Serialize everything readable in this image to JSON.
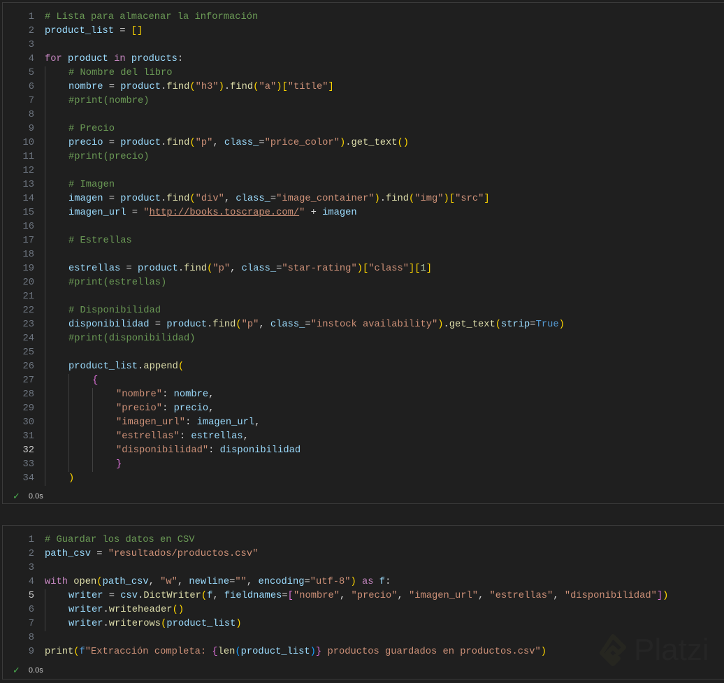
{
  "cells": [
    {
      "active_line": 32,
      "status_time": "0.0s",
      "lines": [
        [
          [
            "c",
            "# Lista para almacenar la información"
          ]
        ],
        [
          [
            "v",
            "product_list"
          ],
          [
            "p",
            " = "
          ],
          [
            "b1",
            "[]"
          ]
        ],
        [],
        [
          [
            "k",
            "for"
          ],
          [
            "p",
            " "
          ],
          [
            "v",
            "product"
          ],
          [
            "p",
            " "
          ],
          [
            "k",
            "in"
          ],
          [
            "p",
            " "
          ],
          [
            "v",
            "products"
          ],
          [
            "p",
            ":"
          ]
        ],
        [
          [
            "p",
            "    "
          ],
          [
            "c",
            "# Nombre del libro"
          ]
        ],
        [
          [
            "p",
            "    "
          ],
          [
            "v",
            "nombre"
          ],
          [
            "p",
            " = "
          ],
          [
            "v",
            "product"
          ],
          [
            "p",
            "."
          ],
          [
            "f",
            "find"
          ],
          [
            "b1",
            "("
          ],
          [
            "s",
            "\"h3\""
          ],
          [
            "b1",
            ")"
          ],
          [
            "p",
            "."
          ],
          [
            "f",
            "find"
          ],
          [
            "b1",
            "("
          ],
          [
            "s",
            "\"a\""
          ],
          [
            "b1",
            ")"
          ],
          [
            "b1",
            "["
          ],
          [
            "s",
            "\"title\""
          ],
          [
            "b1",
            "]"
          ]
        ],
        [
          [
            "p",
            "    "
          ],
          [
            "c",
            "#print(nombre)"
          ]
        ],
        [
          [
            "p",
            "    "
          ]
        ],
        [
          [
            "p",
            "    "
          ],
          [
            "c",
            "# Precio"
          ]
        ],
        [
          [
            "p",
            "    "
          ],
          [
            "v",
            "precio"
          ],
          [
            "p",
            " = "
          ],
          [
            "v",
            "product"
          ],
          [
            "p",
            "."
          ],
          [
            "f",
            "find"
          ],
          [
            "b1",
            "("
          ],
          [
            "s",
            "\"p\""
          ],
          [
            "p",
            ", "
          ],
          [
            "v",
            "class_"
          ],
          [
            "p",
            "="
          ],
          [
            "s",
            "\"price_color\""
          ],
          [
            "b1",
            ")"
          ],
          [
            "p",
            "."
          ],
          [
            "f",
            "get_text"
          ],
          [
            "b1",
            "()"
          ]
        ],
        [
          [
            "p",
            "    "
          ],
          [
            "c",
            "#print(precio)"
          ]
        ],
        [
          [
            "p",
            "    "
          ]
        ],
        [
          [
            "p",
            "    "
          ],
          [
            "c",
            "# Imagen"
          ]
        ],
        [
          [
            "p",
            "    "
          ],
          [
            "v",
            "imagen"
          ],
          [
            "p",
            " = "
          ],
          [
            "v",
            "product"
          ],
          [
            "p",
            "."
          ],
          [
            "f",
            "find"
          ],
          [
            "b1",
            "("
          ],
          [
            "s",
            "\"div\""
          ],
          [
            "p",
            ", "
          ],
          [
            "v",
            "class_"
          ],
          [
            "p",
            "="
          ],
          [
            "s",
            "\"image_container\""
          ],
          [
            "b1",
            ")"
          ],
          [
            "p",
            "."
          ],
          [
            "f",
            "find"
          ],
          [
            "b1",
            "("
          ],
          [
            "s",
            "\"img\""
          ],
          [
            "b1",
            ")"
          ],
          [
            "b1",
            "["
          ],
          [
            "s",
            "\"src\""
          ],
          [
            "b1",
            "]"
          ]
        ],
        [
          [
            "p",
            "    "
          ],
          [
            "v",
            "imagen_url"
          ],
          [
            "p",
            " = "
          ],
          [
            "s",
            "\""
          ],
          [
            "u",
            "http://books.toscrape.com/"
          ],
          [
            "s",
            "\""
          ],
          [
            "p",
            " + "
          ],
          [
            "v",
            "imagen"
          ]
        ],
        [
          [
            "p",
            "    "
          ]
        ],
        [
          [
            "p",
            "    "
          ],
          [
            "c",
            "# Estrellas"
          ]
        ],
        [
          [
            "p",
            "    "
          ]
        ],
        [
          [
            "p",
            "    "
          ],
          [
            "v",
            "estrellas"
          ],
          [
            "p",
            " = "
          ],
          [
            "v",
            "product"
          ],
          [
            "p",
            "."
          ],
          [
            "f",
            "find"
          ],
          [
            "b1",
            "("
          ],
          [
            "s",
            "\"p\""
          ],
          [
            "p",
            ", "
          ],
          [
            "v",
            "class_"
          ],
          [
            "p",
            "="
          ],
          [
            "s",
            "\"star-rating\""
          ],
          [
            "b1",
            ")"
          ],
          [
            "b1",
            "["
          ],
          [
            "s",
            "\"class\""
          ],
          [
            "b1",
            "]"
          ],
          [
            "b1",
            "["
          ],
          [
            "num",
            "1"
          ],
          [
            "b1",
            "]"
          ]
        ],
        [
          [
            "p",
            "    "
          ],
          [
            "c",
            "#print(estrellas)"
          ]
        ],
        [
          [
            "p",
            "    "
          ]
        ],
        [
          [
            "p",
            "    "
          ],
          [
            "c",
            "# Disponibilidad"
          ]
        ],
        [
          [
            "p",
            "    "
          ],
          [
            "v",
            "disponibilidad"
          ],
          [
            "p",
            " = "
          ],
          [
            "v",
            "product"
          ],
          [
            "p",
            "."
          ],
          [
            "f",
            "find"
          ],
          [
            "b1",
            "("
          ],
          [
            "s",
            "\"p\""
          ],
          [
            "p",
            ", "
          ],
          [
            "v",
            "class_"
          ],
          [
            "p",
            "="
          ],
          [
            "s",
            "\"instock availability\""
          ],
          [
            "b1",
            ")"
          ],
          [
            "p",
            "."
          ],
          [
            "f",
            "get_text"
          ],
          [
            "b1",
            "("
          ],
          [
            "v",
            "strip"
          ],
          [
            "p",
            "="
          ],
          [
            "n",
            "True"
          ],
          [
            "b1",
            ")"
          ]
        ],
        [
          [
            "p",
            "    "
          ],
          [
            "c",
            "#print(disponibilidad)"
          ]
        ],
        [
          [
            "p",
            "    "
          ]
        ],
        [
          [
            "p",
            "    "
          ],
          [
            "v",
            "product_list"
          ],
          [
            "p",
            "."
          ],
          [
            "f",
            "append"
          ],
          [
            "b1",
            "("
          ]
        ],
        [
          [
            "p",
            "        "
          ],
          [
            "b2",
            "{"
          ]
        ],
        [
          [
            "p",
            "            "
          ],
          [
            "s",
            "\"nombre\""
          ],
          [
            "p",
            ": "
          ],
          [
            "v",
            "nombre"
          ],
          [
            "p",
            ","
          ]
        ],
        [
          [
            "p",
            "            "
          ],
          [
            "s",
            "\"precio\""
          ],
          [
            "p",
            ": "
          ],
          [
            "v",
            "precio"
          ],
          [
            "p",
            ","
          ]
        ],
        [
          [
            "p",
            "            "
          ],
          [
            "s",
            "\"imagen_url\""
          ],
          [
            "p",
            ": "
          ],
          [
            "v",
            "imagen_url"
          ],
          [
            "p",
            ","
          ]
        ],
        [
          [
            "p",
            "            "
          ],
          [
            "s",
            "\"estrellas\""
          ],
          [
            "p",
            ": "
          ],
          [
            "v",
            "estrellas"
          ],
          [
            "p",
            ","
          ]
        ],
        [
          [
            "p",
            "            "
          ],
          [
            "s",
            "\"disponibilidad\""
          ],
          [
            "p",
            ": "
          ],
          [
            "v",
            "disponibilidad"
          ]
        ],
        [
          [
            "p",
            "            "
          ],
          [
            "b2",
            "}"
          ]
        ],
        [
          [
            "p",
            "    "
          ],
          [
            "b1",
            ")"
          ]
        ]
      ]
    },
    {
      "active_line": 5,
      "status_time": "0.0s",
      "lines": [
        [
          [
            "c",
            "# Guardar los datos en CSV"
          ]
        ],
        [
          [
            "v",
            "path_csv"
          ],
          [
            "p",
            " = "
          ],
          [
            "s",
            "\"resultados/productos.csv\""
          ]
        ],
        [],
        [
          [
            "k",
            "with"
          ],
          [
            "p",
            " "
          ],
          [
            "f",
            "open"
          ],
          [
            "b1",
            "("
          ],
          [
            "v",
            "path_csv"
          ],
          [
            "p",
            ", "
          ],
          [
            "s",
            "\"w\""
          ],
          [
            "p",
            ", "
          ],
          [
            "v",
            "newline"
          ],
          [
            "p",
            "="
          ],
          [
            "s",
            "\"\""
          ],
          [
            "p",
            ", "
          ],
          [
            "v",
            "encoding"
          ],
          [
            "p",
            "="
          ],
          [
            "s",
            "\"utf-8\""
          ],
          [
            "b1",
            ")"
          ],
          [
            "p",
            " "
          ],
          [
            "k",
            "as"
          ],
          [
            "p",
            " "
          ],
          [
            "v",
            "f"
          ],
          [
            "p",
            ":"
          ]
        ],
        [
          [
            "p",
            "    "
          ],
          [
            "v",
            "writer"
          ],
          [
            "p",
            " = "
          ],
          [
            "v",
            "csv"
          ],
          [
            "p",
            "."
          ],
          [
            "f",
            "DictWriter"
          ],
          [
            "b1",
            "("
          ],
          [
            "v",
            "f"
          ],
          [
            "p",
            ", "
          ],
          [
            "v",
            "fieldnames"
          ],
          [
            "p",
            "="
          ],
          [
            "b2",
            "["
          ],
          [
            "s",
            "\"nombre\""
          ],
          [
            "p",
            ", "
          ],
          [
            "s",
            "\"precio\""
          ],
          [
            "p",
            ", "
          ],
          [
            "s",
            "\"imagen_url\""
          ],
          [
            "p",
            ", "
          ],
          [
            "s",
            "\"estrellas\""
          ],
          [
            "p",
            ", "
          ],
          [
            "s",
            "\"disponibilidad\""
          ],
          [
            "b2",
            "]"
          ],
          [
            "b1",
            ")"
          ]
        ],
        [
          [
            "p",
            "    "
          ],
          [
            "v",
            "writer"
          ],
          [
            "p",
            "."
          ],
          [
            "f",
            "writeheader"
          ],
          [
            "b1",
            "()"
          ]
        ],
        [
          [
            "p",
            "    "
          ],
          [
            "v",
            "writer"
          ],
          [
            "p",
            "."
          ],
          [
            "f",
            "writerows"
          ],
          [
            "b1",
            "("
          ],
          [
            "v",
            "product_list"
          ],
          [
            "b1",
            ")"
          ]
        ],
        [],
        [
          [
            "f",
            "print"
          ],
          [
            "b1",
            "("
          ],
          [
            "n",
            "f"
          ],
          [
            "s",
            "\"Extracción completa: "
          ],
          [
            "b2",
            "{"
          ],
          [
            "f",
            "len"
          ],
          [
            "b3",
            "("
          ],
          [
            "v",
            "product_list"
          ],
          [
            "b3",
            ")"
          ],
          [
            "b2",
            "}"
          ],
          [
            "s",
            " productos guardados en productos.csv\""
          ],
          [
            "b1",
            ")"
          ]
        ]
      ]
    }
  ],
  "watermark": "Platzi",
  "icons": {
    "status": "check-icon",
    "logo": "platzi-logo-icon"
  },
  "colors": {
    "comment": "#6A9955",
    "variable": "#9CDCFE",
    "function": "#DCDCAA",
    "string": "#CE9178",
    "keyword": "#C586C0",
    "success": "#4caf50"
  }
}
